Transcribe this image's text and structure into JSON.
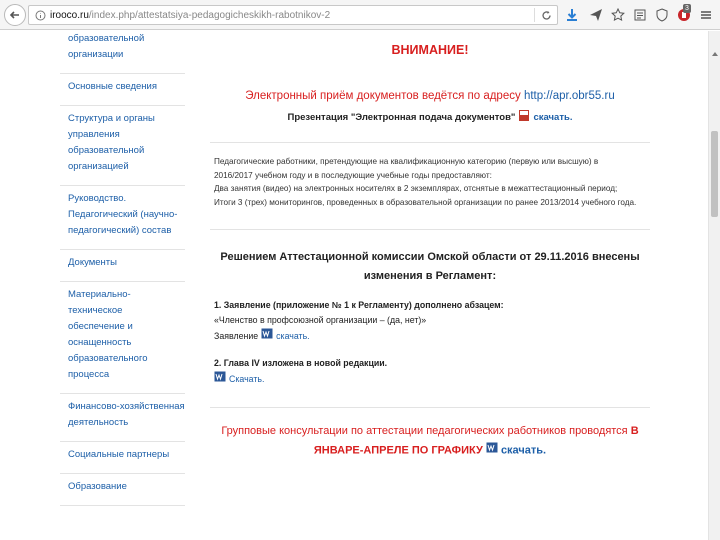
{
  "browser": {
    "url_domain": "irooco.ru",
    "url_path": "/index.php/attestatsiya-pedagogicheskikh-rabotnikov-2",
    "badge": "3"
  },
  "sidebar": {
    "items": [
      {
        "lines": [
          "образовательной",
          "организации"
        ]
      },
      {
        "lines": [
          "Основные сведения"
        ]
      },
      {
        "lines": [
          "Структура и органы",
          "управления",
          "образовательной",
          "организацией"
        ]
      },
      {
        "lines": [
          "Руководство.",
          "Педагогический (научно-",
          "педагогический) состав"
        ]
      },
      {
        "lines": [
          "Документы"
        ]
      },
      {
        "lines": [
          "Материально-техническое",
          "обеспечение и",
          "оснащенность",
          "образовательного",
          "процесса"
        ]
      },
      {
        "lines": [
          "Финансово-хозяйственная",
          "деятельность"
        ]
      },
      {
        "lines": [
          "Социальные партнеры"
        ]
      },
      {
        "lines": [
          "Образование"
        ]
      }
    ]
  },
  "main": {
    "warning_title": "ВНИМАНИЕ!",
    "notice_text": "Электронный приём документов ведётся по адресу",
    "notice_site": "http://apr.obr55.ru",
    "presentation_text": "Презентация \"Электронная подача документов\"",
    "presentation_link": "скачать.",
    "paragraph": [
      "Педагогические работники, претендующие на квалификационную категорию (первую или высшую) в",
      "2016/2017 учебном году и в последующие учебные годы предоставляют:",
      "Два занятия (видео) на электронных носителях в 2 экземплярах, отснятые в межаттестационный период;",
      "Итоги 3 (трех) мониторингов, проведенных в образовательной организации по ранее 2013/2014 учебного года."
    ],
    "decision": "Решением Аттестационной комиссии Омской области от 29.11.2016 внесены изменения в Регламент:",
    "item1_heading": "1. Заявление (приложение № 1 к Регламенту) дополнено абзацем:",
    "item1_text": "«Членство в профсоюзной организации – (да, нет)»",
    "item1_label": "Заявление",
    "item1_link": "скачать.",
    "item2_heading": "2. Глава IV изложена в новой редакции.",
    "item2_link": "Скачать.",
    "consult_text": "Групповые консультации по аттестации педагогических работников проводятся",
    "consult_bold": "В ЯНВАРЕ-АПРЕЛЕ ПО ГРАФИКУ",
    "consult_link": "скачать."
  },
  "colors": {
    "alert_red": "#d81f1f",
    "link_blue": "#1d5fa8"
  }
}
